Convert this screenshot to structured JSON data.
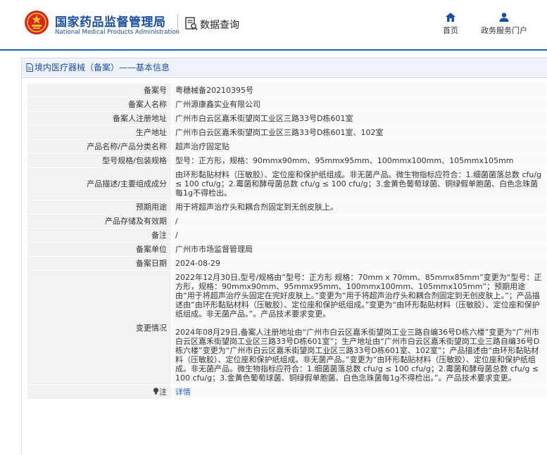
{
  "header": {
    "brand_cn": "国家药品监督管理局",
    "brand_en": "National Medical Products Administration",
    "db_title": "数据查询",
    "nav": [
      {
        "label": "首页",
        "icon": "home-icon"
      },
      {
        "label": "政务服务门户",
        "icon": "user-icon"
      }
    ]
  },
  "panel": {
    "breadcrumb": "境内医疗器械（备案）——基本信息"
  },
  "fields": [
    {
      "label": "备案号",
      "value": "粤穗械备20210395号"
    },
    {
      "label": "备案人名称",
      "value": "广州源康鑫实业有限公司"
    },
    {
      "label": "备案人注册地址",
      "value": "广州市白云区嘉禾街望岗工业区三路33号D栋601室"
    },
    {
      "label": "生产地址",
      "value": "广州市白云区嘉禾街望岗工业区三路33号D栋601室、102室"
    },
    {
      "label": "产品名称/产品分类名称",
      "value": "超声治疗固定贴"
    },
    {
      "label": "型号规格/包装规格",
      "value": "型号：正方形，规格：90mmx90mm、95mmx95mm、100mmx100mm、105mmx105mm"
    },
    {
      "label": "产品描述/主要组成成分",
      "value": "由环形黏贴材料（压敏胶）、定位座和保护纸组成。非无菌产品。微生物指标应符合：1.细菌菌落总数 cfu/g ≤ 100 cfu/g；2.霉菌和酵母菌总数 cfu/g ≤ 100 cfu/g；3.金黄色葡萄球菌、铜绿假单胞菌、白色念珠菌每1g不得检出。"
    },
    {
      "label": "预期用途",
      "value": "用于将超声治疗头和耦合剂固定到无创皮肤上。"
    },
    {
      "label": "产品存储及有效期",
      "value": "/"
    },
    {
      "label": "备注",
      "value": "/"
    },
    {
      "label": "备案单位",
      "value": "广州市市场监督管理局"
    },
    {
      "label": "备案日期",
      "value": "2024-08-29"
    }
  ],
  "changes": {
    "label": "变更情况",
    "entries": [
      "2022年12月30日,型号/规格由“型号：正方形 规格：70mm x 70mm、85mmx85mm”变更为“型号：正方形，规格：90mmx90mm、95mmx95mm、100mmx100mm、105mmx105mm”；预期用途由“用于将超声治疗头固定在完好皮肤上。”变更为“用于将超声治疗头和耦合剂固定到无创皮肤上。”；产品描述由“由环形黏贴材料（压敏胶）、定位座和保护纸组成。”变更为“由环形黏贴材料（压敏胶）、定位座和保护纸组成。非无菌产品。”。产品技术要求变更。",
      "2024年08月29日,备案人注册地址由“广州市白云区嘉禾街望岗工业三路自编36号D栋六楼”变更为“广州市白云区嘉禾街望岗工业区三路33号D栋601室”；生产地址由“广州市白云区嘉禾街望岗工业三路自编36号D栋六楼”变更为“广州市白云区嘉禾街望岗工业区三路33号D栋601室、102室”；产品描述由“由环形黏贴材料（压敏胶）、定位座和保护纸组成。非无菌产品。”变更为“由环形黏贴材料（压敏胶）、定位座和保护纸组成。非无菌产品。微生物指标应符合：1.细菌菌落总数 cfu/g ≤ 100 cfu/g；2.霉菌和酵母菌总数 cfu/g ≤ 100 cfu/g；3.金黄色葡萄球菌、铜绿假单胞菌、白色念珠菌每1g不得检出。”。产品技术要求变更。"
    ]
  },
  "note": {
    "label": "注",
    "link_text": "详情",
    "icon": "lightbulb-icon"
  },
  "colors": {
    "brand_blue": "#1c4fa0",
    "link_blue": "#1c5fc4",
    "label_bg": "#f2f2f2",
    "value_bg": "#fafafa"
  }
}
